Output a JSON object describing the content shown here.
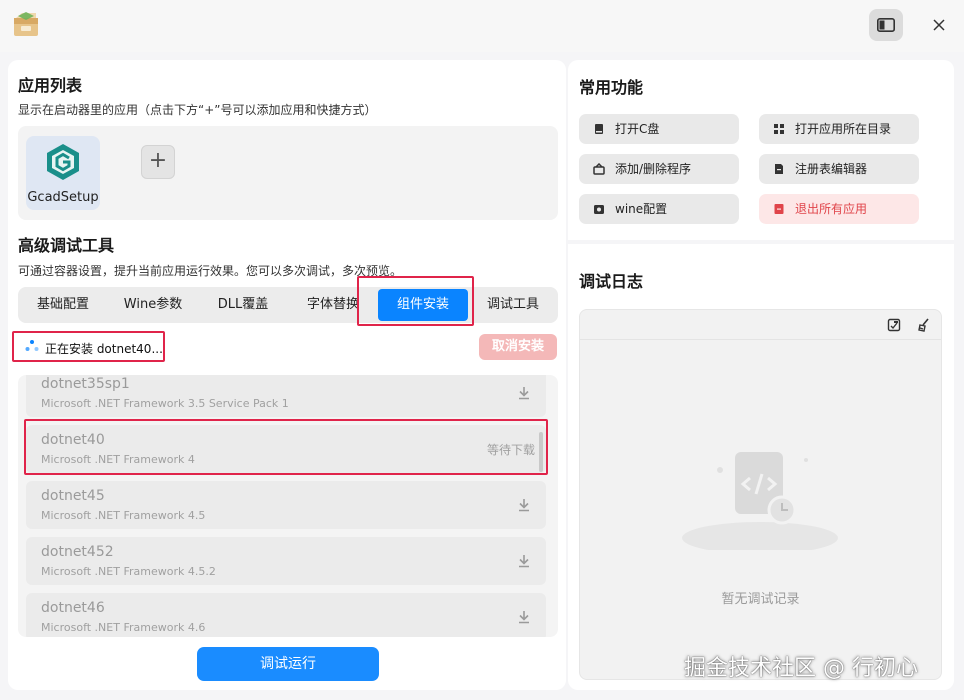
{
  "titlebar": {
    "logo_icon": "package-box-icon",
    "sidebar_toggle_icon": "sidebar-toggle-icon",
    "close_icon": "close-icon"
  },
  "app_list": {
    "title": "应用列表",
    "description": "显示在启动器里的应用（点击下方“+”号可以添加应用和快捷方式）",
    "apps": [
      {
        "name": "GcadSetup",
        "icon": "gcad-app-icon"
      }
    ],
    "add_symbol": "+"
  },
  "debug_tools": {
    "title": "高级调试工具",
    "description": "可通过容器设置，提升当前应用运行效果。您可以多次调试，多次预览。",
    "tabs": [
      {
        "label": "基础配置",
        "active": false
      },
      {
        "label": "Wine参数",
        "active": false
      },
      {
        "label": "DLL覆盖",
        "active": false
      },
      {
        "label": "字体替换",
        "active": false
      },
      {
        "label": "组件安装",
        "active": true
      },
      {
        "label": "调试工具",
        "active": false
      }
    ],
    "installing_status": "正在安装 dotnet40...",
    "cancel_label": "取消安装",
    "components": [
      {
        "name": "dotnet35sp1",
        "desc": "Microsoft .NET Framework 3.5 Service Pack 1",
        "status": ""
      },
      {
        "name": "dotnet40",
        "desc": "Microsoft .NET Framework 4",
        "status": "等待下载"
      },
      {
        "name": "dotnet45",
        "desc": "Microsoft .NET Framework 4.5",
        "status": ""
      },
      {
        "name": "dotnet452",
        "desc": "Microsoft .NET Framework 4.5.2",
        "status": ""
      },
      {
        "name": "dotnet46",
        "desc": "Microsoft .NET Framework 4.6",
        "status": ""
      }
    ],
    "run_label": "调试运行"
  },
  "common_functions": {
    "title": "常用功能",
    "buttons": [
      {
        "label": "打开C盘",
        "icon": "drive-icon",
        "danger": false
      },
      {
        "label": "打开应用所在目录",
        "icon": "folder-grid-icon",
        "danger": false
      },
      {
        "label": "添加/删除程序",
        "icon": "package-icon",
        "danger": false
      },
      {
        "label": "注册表编辑器",
        "icon": "registry-file-icon",
        "danger": false
      },
      {
        "label": "wine配置",
        "icon": "wine-config-icon",
        "danger": false
      },
      {
        "label": "退出所有应用",
        "icon": "exit-icon",
        "danger": true
      }
    ]
  },
  "debug_log": {
    "title": "调试日志",
    "empty_text": "暂无调试记录",
    "toolbar_icons": [
      "copy-log-icon",
      "clear-log-icon"
    ]
  },
  "watermark": "掘金技术社区 @ 行初心",
  "colors": {
    "accent": "#0a84ff",
    "danger": "#e0444a",
    "highlight_box": "#e0244a"
  }
}
